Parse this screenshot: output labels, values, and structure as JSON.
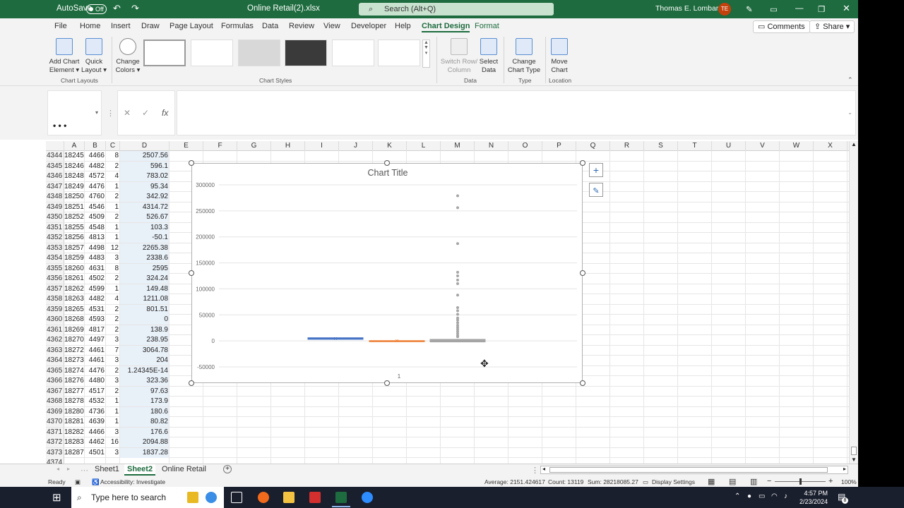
{
  "titlebar": {
    "autosave_label": "AutoSave",
    "autosave_state": "Off",
    "filename": "Online Retail(2).xlsx",
    "search_placeholder": "Search (Alt+Q)",
    "user": "Thomas E. Lombardi",
    "initials": "TE"
  },
  "tabs": [
    "File",
    "Home",
    "Insert",
    "Draw",
    "Page Layout",
    "Formulas",
    "Data",
    "Review",
    "View",
    "Developer",
    "Help",
    "Chart Design",
    "Format"
  ],
  "active_tab": "Chart Design",
  "comments_label": "Comments",
  "share_label": "Share",
  "ribbon": {
    "add_chart_element": [
      "Add Chart",
      "Element ▾"
    ],
    "quick_layout": [
      "Quick",
      "Layout ▾"
    ],
    "chart_layouts_label": "Chart Layouts",
    "change_colors": [
      "Change",
      "Colors ▾"
    ],
    "chart_styles_label": "Chart Styles",
    "switch_row_col": [
      "Switch Row/",
      "Column"
    ],
    "select_data": [
      "Select",
      "Data"
    ],
    "data_label": "Data",
    "change_chart_type": [
      "Change",
      "Chart Type"
    ],
    "type_label": "Type",
    "move_chart": [
      "Move",
      "Chart"
    ],
    "location_label": "Location"
  },
  "formula_bar": {
    "name_box": "• • •",
    "fx": "fx"
  },
  "columns": [
    "A",
    "B",
    "C",
    "D",
    "E",
    "F",
    "G",
    "H",
    "I",
    "J",
    "K",
    "L",
    "M",
    "N",
    "O",
    "P",
    "Q",
    "R",
    "S",
    "T",
    "U",
    "V",
    "W",
    "X"
  ],
  "rows": [
    [
      "4344",
      "18245",
      "4466",
      "8",
      "2507.56"
    ],
    [
      "4345",
      "18246",
      "4482",
      "2",
      "596.1"
    ],
    [
      "4346",
      "18248",
      "4572",
      "4",
      "783.02"
    ],
    [
      "4347",
      "18249",
      "4476",
      "1",
      "95.34"
    ],
    [
      "4348",
      "18250",
      "4760",
      "2",
      "342.92"
    ],
    [
      "4349",
      "18251",
      "4546",
      "1",
      "4314.72"
    ],
    [
      "4350",
      "18252",
      "4509",
      "2",
      "526.67"
    ],
    [
      "4351",
      "18255",
      "4548",
      "1",
      "103.3"
    ],
    [
      "4352",
      "18256",
      "4813",
      "1",
      "-50.1"
    ],
    [
      "4353",
      "18257",
      "4498",
      "12",
      "2265.38"
    ],
    [
      "4354",
      "18259",
      "4483",
      "3",
      "2338.6"
    ],
    [
      "4355",
      "18260",
      "4631",
      "8",
      "2595"
    ],
    [
      "4356",
      "18261",
      "4502",
      "2",
      "324.24"
    ],
    [
      "4357",
      "18262",
      "4599",
      "1",
      "149.48"
    ],
    [
      "4358",
      "18263",
      "4482",
      "4",
      "1211.08"
    ],
    [
      "4359",
      "18265",
      "4531",
      "2",
      "801.51"
    ],
    [
      "4360",
      "18268",
      "4593",
      "2",
      "0"
    ],
    [
      "4361",
      "18269",
      "4817",
      "2",
      "138.9"
    ],
    [
      "4362",
      "18270",
      "4497",
      "3",
      "238.95"
    ],
    [
      "4363",
      "18272",
      "4461",
      "7",
      "3064.78"
    ],
    [
      "4364",
      "18273",
      "4461",
      "3",
      "204"
    ],
    [
      "4365",
      "18274",
      "4476",
      "2",
      "1.24345E-14"
    ],
    [
      "4366",
      "18276",
      "4480",
      "3",
      "323.36"
    ],
    [
      "4367",
      "18277",
      "4517",
      "2",
      "97.63"
    ],
    [
      "4368",
      "18278",
      "4532",
      "1",
      "173.9"
    ],
    [
      "4369",
      "18280",
      "4736",
      "1",
      "180.6"
    ],
    [
      "4370",
      "18281",
      "4639",
      "1",
      "80.82"
    ],
    [
      "4371",
      "18282",
      "4466",
      "3",
      "176.6"
    ],
    [
      "4372",
      "18283",
      "4462",
      "16",
      "2094.88"
    ],
    [
      "4373",
      "18287",
      "4501",
      "3",
      "1837.28"
    ],
    [
      "4374",
      "",
      "",
      "",
      ""
    ]
  ],
  "chart_data": {
    "type": "box",
    "title": "Chart Title",
    "categories": [
      "1"
    ],
    "ylim": [
      -50000,
      300000
    ],
    "yticks": [
      300000,
      250000,
      200000,
      150000,
      100000,
      50000,
      0,
      -50000
    ],
    "grid": true,
    "series": [
      {
        "color": "#4472c4",
        "mean": 4500,
        "box": [
          3000,
          6000
        ]
      },
      {
        "color": "#ed7d31",
        "mean": 0,
        "box": [
          -500,
          500
        ]
      },
      {
        "color": "#a5a5a5",
        "mean": 1000,
        "box": [
          -2000,
          3000
        ],
        "outliers": [
          279000,
          256000,
          187000,
          132000,
          125000,
          117000,
          110000,
          88000,
          64000,
          58000,
          51000,
          44000,
          40000,
          35000,
          30000,
          26000,
          22000,
          18000,
          14000,
          10000,
          8000
        ]
      }
    ]
  },
  "sheets": [
    "Sheet1",
    "Sheet2",
    "Online Retail"
  ],
  "active_sheet": "Sheet2",
  "status": {
    "ready": "Ready",
    "accessibility": "Accessibility: Investigate",
    "average": "Average: 2151.424617",
    "count": "Count: 13119",
    "sum": "Sum: 28218085.27",
    "display_settings": "Display Settings",
    "zoom": "100%"
  },
  "taskbar": {
    "search_placeholder": "Type here to search",
    "time": "4:57 PM",
    "date": "2/23/2024",
    "notif": "8"
  }
}
